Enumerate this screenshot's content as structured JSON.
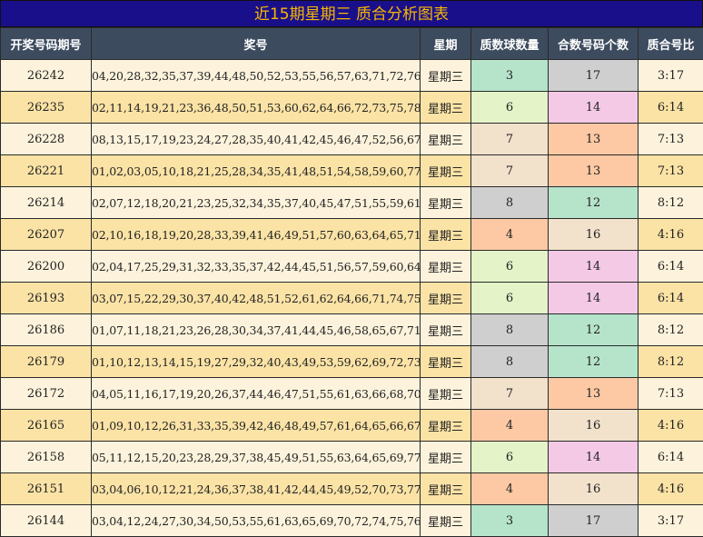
{
  "title": "近15期星期三 质合分析图表",
  "headers": [
    "开奖号码期号",
    "奖号",
    "星期",
    "质数球数量",
    "合数号码个数",
    "质合号比"
  ],
  "colors": {
    "c3": "#b6e4cb",
    "c4": "#fcc9a4",
    "c6": "#e4f3c8",
    "c7": "#f2e1cb",
    "c8": "#cfcfcf",
    "h12": "#b6e4cb",
    "h13": "#fcc9a4",
    "h14": "#f4c9e6",
    "h16": "#f2e1cb",
    "h17": "#cfcfcf"
  },
  "rows": [
    {
      "issue": "26242",
      "nums": "04,20,28,32,35,37,39,44,48,50,52,53,55,56,57,63,71,72,76,77",
      "week": "星期三",
      "prime": "3",
      "composite": "17",
      "ratio": "3:17"
    },
    {
      "issue": "26235",
      "nums": "02,11,14,19,21,23,36,48,50,51,53,60,62,64,66,72,73,75,78,80",
      "week": "星期三",
      "prime": "6",
      "composite": "14",
      "ratio": "6:14"
    },
    {
      "issue": "26228",
      "nums": "08,13,15,17,19,23,24,27,28,35,40,41,42,45,46,47,52,56,67,80",
      "week": "星期三",
      "prime": "7",
      "composite": "13",
      "ratio": "7:13"
    },
    {
      "issue": "26221",
      "nums": "01,02,03,05,10,18,21,25,28,34,35,41,48,51,54,58,59,60,77,79",
      "week": "星期三",
      "prime": "7",
      "composite": "13",
      "ratio": "7:13"
    },
    {
      "issue": "26214",
      "nums": "02,07,12,18,20,21,23,25,32,34,35,37,40,45,47,51,55,59,61,71",
      "week": "星期三",
      "prime": "8",
      "composite": "12",
      "ratio": "8:12"
    },
    {
      "issue": "26207",
      "nums": "02,10,16,18,19,20,28,33,39,41,46,49,51,57,60,63,64,65,71,76",
      "week": "星期三",
      "prime": "4",
      "composite": "16",
      "ratio": "4:16"
    },
    {
      "issue": "26200",
      "nums": "02,04,17,25,29,31,32,33,35,37,42,44,45,51,56,57,59,60,64,66",
      "week": "星期三",
      "prime": "6",
      "composite": "14",
      "ratio": "6:14"
    },
    {
      "issue": "26193",
      "nums": "03,07,15,22,29,30,37,40,42,48,51,52,61,62,64,66,71,74,75,78",
      "week": "星期三",
      "prime": "6",
      "composite": "14",
      "ratio": "6:14"
    },
    {
      "issue": "26186",
      "nums": "01,07,11,18,21,23,26,28,30,34,37,41,44,45,46,58,65,67,71,80",
      "week": "星期三",
      "prime": "8",
      "composite": "12",
      "ratio": "8:12"
    },
    {
      "issue": "26179",
      "nums": "01,10,12,13,14,15,19,27,29,32,40,43,49,53,59,62,69,72,73,80",
      "week": "星期三",
      "prime": "8",
      "composite": "12",
      "ratio": "8:12"
    },
    {
      "issue": "26172",
      "nums": "04,05,11,16,17,19,20,26,37,44,46,47,51,55,61,63,66,68,70,75",
      "week": "星期三",
      "prime": "7",
      "composite": "13",
      "ratio": "7:13"
    },
    {
      "issue": "26165",
      "nums": "01,09,10,12,26,31,33,35,39,42,46,48,49,57,61,64,65,66,67,74",
      "week": "星期三",
      "prime": "4",
      "composite": "16",
      "ratio": "4:16"
    },
    {
      "issue": "26158",
      "nums": "05,11,12,15,20,23,28,29,37,38,45,49,51,55,63,64,65,69,77,79",
      "week": "星期三",
      "prime": "6",
      "composite": "14",
      "ratio": "6:14"
    },
    {
      "issue": "26151",
      "nums": "03,04,06,10,12,21,24,36,37,38,41,42,44,45,49,52,70,73,77,78",
      "week": "星期三",
      "prime": "4",
      "composite": "16",
      "ratio": "4:16"
    },
    {
      "issue": "26144",
      "nums": "03,04,12,24,27,30,34,50,53,55,61,63,65,69,70,72,74,75,76,77",
      "week": "星期三",
      "prime": "3",
      "composite": "17",
      "ratio": "3:17"
    }
  ]
}
